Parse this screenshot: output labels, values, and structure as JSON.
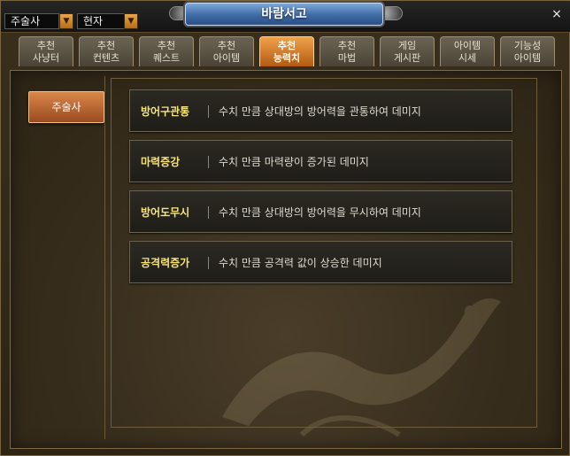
{
  "window": {
    "title": "바람서고",
    "close_label": "×"
  },
  "dropdowns": [
    {
      "value": "주술사",
      "arrow": "▼"
    },
    {
      "value": "현자",
      "arrow": "▼"
    }
  ],
  "tabs": [
    {
      "line1": "추천",
      "line2": "사냥터",
      "active": false
    },
    {
      "line1": "추천",
      "line2": "컨텐츠",
      "active": false
    },
    {
      "line1": "추천",
      "line2": "퀘스트",
      "active": false
    },
    {
      "line1": "추천",
      "line2": "아이템",
      "active": false
    },
    {
      "line1": "추천",
      "line2": "능력치",
      "active": true
    },
    {
      "line1": "추천",
      "line2": "마법",
      "active": false
    },
    {
      "line1": "게임",
      "line2": "게시판",
      "active": false
    },
    {
      "line1": "아이템",
      "line2": "시세",
      "active": false
    },
    {
      "line1": "기능성",
      "line2": "아이템",
      "active": false
    }
  ],
  "sidebar": {
    "selected_label": "주술사"
  },
  "stats": [
    {
      "name": "방어구관통",
      "desc": "수치 만큼 상대방의 방어력을 관통하여 데미지"
    },
    {
      "name": "마력증강",
      "desc": "수치 만큼 마력량이 증가된 데미지"
    },
    {
      "name": "방어도무시",
      "desc": "수치 만큼 상대방의 방어력을 무시하여 데미지"
    },
    {
      "name": "공격력증가",
      "desc": "수치 만큼 공격력 값이 상승한 데미지"
    }
  ],
  "colors": {
    "accent_tab": "#e08a36",
    "stat_name": "#f6e47a",
    "title_plate": "#3f6ba6"
  }
}
